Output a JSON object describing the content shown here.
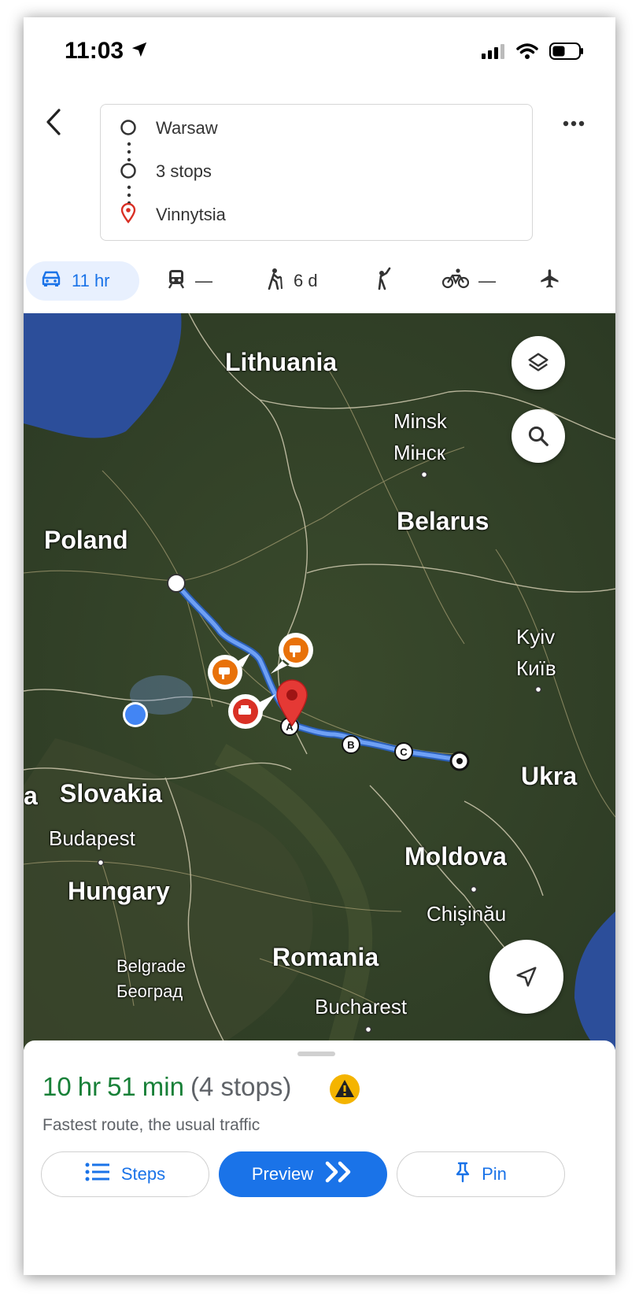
{
  "status": {
    "time": "11:03"
  },
  "route": {
    "origin": "Warsaw",
    "middle": "3 stops",
    "destination": "Vinnytsia"
  },
  "modes": [
    {
      "name": "drive",
      "label": "11 hr"
    },
    {
      "name": "transit",
      "label": "—"
    },
    {
      "name": "walk",
      "label": "6 d"
    },
    {
      "name": "ride",
      "label": ""
    },
    {
      "name": "bike",
      "label": "—"
    },
    {
      "name": "flight",
      "label": ""
    }
  ],
  "map": {
    "labels": {
      "lithuania": "Lithuania",
      "minsk": "Minsk",
      "minsk_cyr": "Мінск",
      "belarus": "Belarus",
      "poland": "Poland",
      "kyiv": "Kyiv",
      "kyiv_cyr": "Київ",
      "ukraine": "Ukra",
      "slovakia": "Slovakia",
      "edge_a": "a",
      "budapest": "Budapest",
      "hungary": "Hungary",
      "moldova": "Moldova",
      "chisinau": "Chişinău",
      "belgrade": "Belgrade",
      "belgrade_cyr": "Београд",
      "romania": "Romania",
      "bucharest": "Bucharest"
    },
    "waypoints": [
      "A",
      "B",
      "C"
    ]
  },
  "summary": {
    "hours": "10",
    "hr_label": "hr",
    "mins": "51",
    "min_label": "min",
    "stops": "(4 stops)",
    "subtitle": "Fastest route, the usual traffic"
  },
  "buttons": {
    "steps": "Steps",
    "preview": "Preview",
    "pin": "Pin"
  },
  "colors": {
    "accent": "#1a73e8",
    "route": "#4d8ff0",
    "duration_green": "#188038",
    "warning": "#f4b400"
  }
}
